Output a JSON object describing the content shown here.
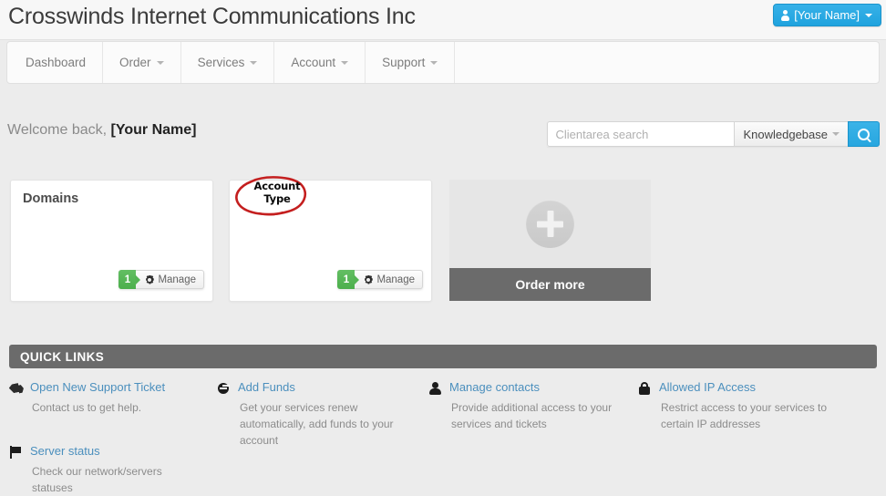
{
  "header": {
    "brand_title": "Crosswinds Internet Communications Inc",
    "user_button_label": "[Your Name]",
    "user_icon": "person-icon",
    "caret_icon": "caret-down-icon",
    "background": "#f7f7f7",
    "accent_blue": "#27a6df"
  },
  "nav": {
    "items": [
      {
        "label": "Dashboard",
        "has_caret": false
      },
      {
        "label": "Order",
        "has_caret": true
      },
      {
        "label": "Services",
        "has_caret": true
      },
      {
        "label": "Account",
        "has_caret": true
      },
      {
        "label": "Support",
        "has_caret": true
      }
    ]
  },
  "welcome": {
    "greeting": "Welcome back,",
    "user_name": "[Your Name]"
  },
  "search": {
    "placeholder": "Clientarea search",
    "value": "",
    "scope_label": "Knowledgebase",
    "scope_caret": "caret-down-icon",
    "button_icon": "search-icon",
    "button_color": "#27a6df"
  },
  "cards": [
    {
      "title": "Domains",
      "count": "1",
      "manage_label": "Manage",
      "manage_icon": "gear-icon",
      "badge_color": "#55b455"
    },
    {
      "title": "",
      "count": "1",
      "manage_label": "Manage",
      "manage_icon": "gear-icon",
      "badge_color": "#55b455"
    }
  ],
  "order_card": {
    "plus_icon": "plus-circle-icon",
    "label": "Order more",
    "bar_color": "#6b6b6b"
  },
  "annotation": {
    "line1": "Account",
    "line2": "Type",
    "color": "#c41f1f",
    "shape": "ellipse-circle"
  },
  "quick_links": {
    "heading": "QUICK LINKS",
    "heading_bar_color": "#6b6b6b",
    "items": [
      {
        "icon": "tag-icon",
        "title": "Open New Support Ticket",
        "description": "Contact us to get help."
      },
      {
        "icon": "plus-circle-icon",
        "title": "Add Funds",
        "description": "Get your services renew automatically, add funds to your account"
      },
      {
        "icon": "person-icon",
        "title": "Manage contacts",
        "description": "Provide additional access to your services and tickets"
      },
      {
        "icon": "lock-icon",
        "title": "Allowed IP Access",
        "description": "Restrict access to your services to certain IP addresses"
      },
      {
        "icon": "flag-icon",
        "title": "Server status",
        "description": "Check our network/servers statuses"
      }
    ]
  }
}
